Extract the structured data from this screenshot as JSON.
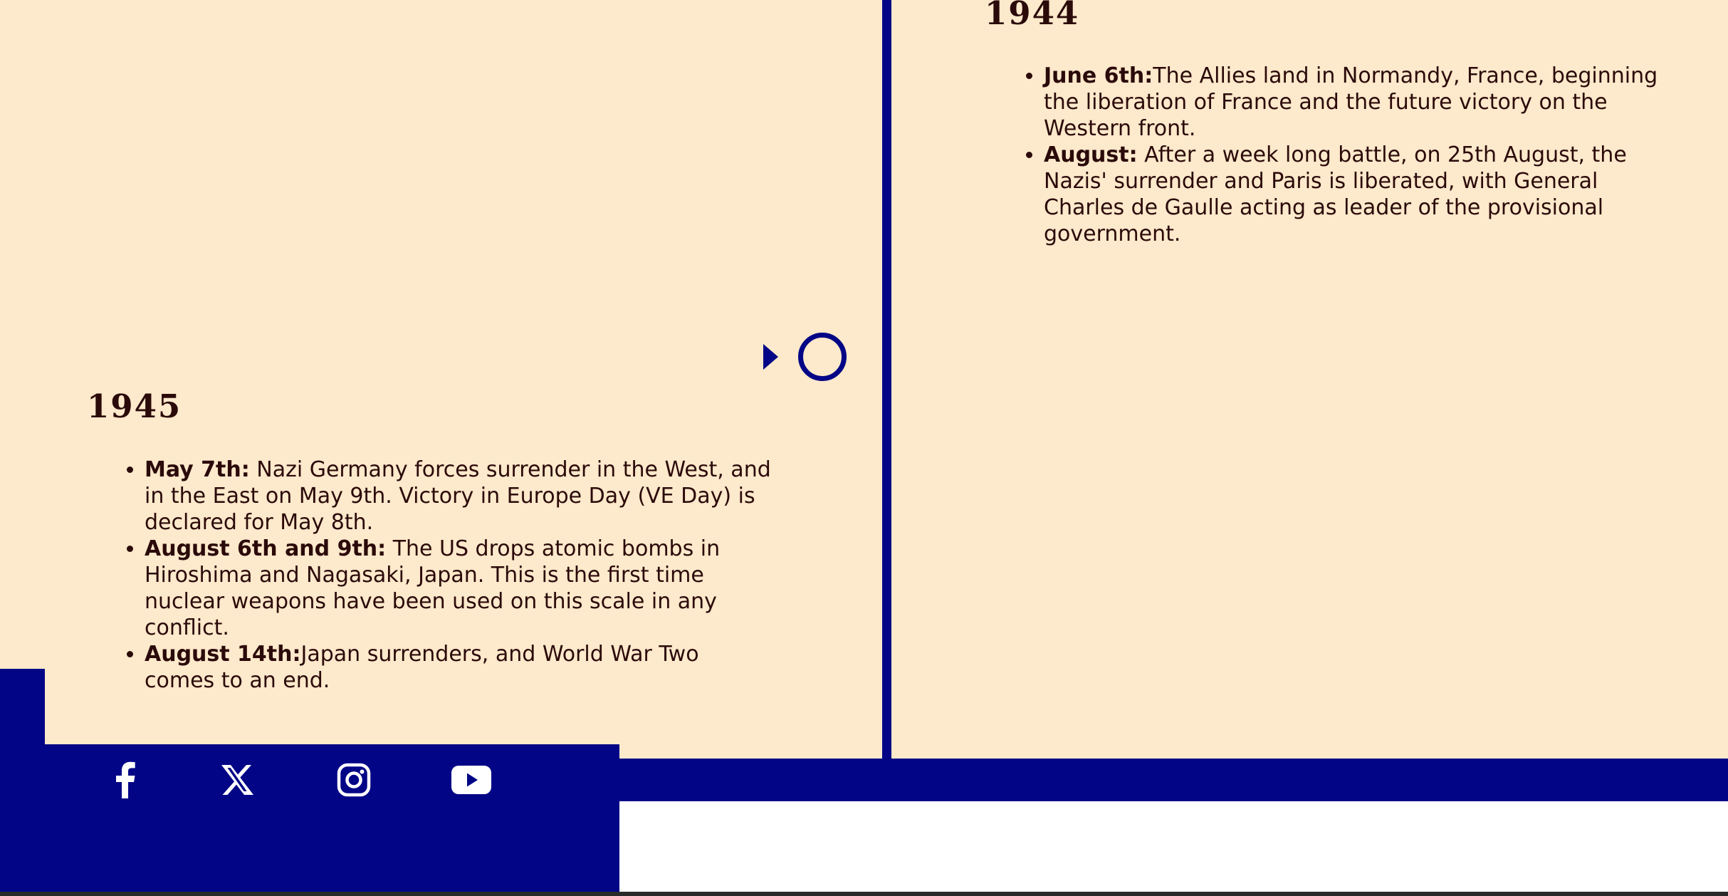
{
  "timeline": {
    "entries": [
      {
        "year": "1944",
        "events": [
          {
            "label": "June 6th:",
            "text": "The Allies land in Normandy, France, beginning the liberation of France and the future victory on the Western front."
          },
          {
            "label": "August:",
            "text": " After a week long battle, on 25th August, the Nazis' surrender and Paris is liberated, with General Charles de Gaulle acting as leader of the provisional government."
          }
        ]
      },
      {
        "year": "1945",
        "events": [
          {
            "label": "May 7th:",
            "text": " Nazi Germany forces surrender in the West, and in the East on May 9th. Victory in Europe Day (VE Day) is declared for May 8th."
          },
          {
            "label": "August 6th and 9th:",
            "text": " The US drops atomic bombs in Hiroshima and Nagasaki, Japan. This is the first time nuclear weapons have been used on this scale in any conflict."
          },
          {
            "label": "August 14th:",
            "text": "Japan surrenders, and World War Two comes to an end."
          }
        ]
      }
    ]
  },
  "footer": {
    "social": [
      {
        "icon": "facebook-icon"
      },
      {
        "icon": "x-icon"
      },
      {
        "icon": "instagram-icon"
      },
      {
        "icon": "youtube-icon"
      }
    ]
  },
  "colors": {
    "background": "#fde9cb",
    "accent": "#020686",
    "text": "#2b0a0a"
  }
}
